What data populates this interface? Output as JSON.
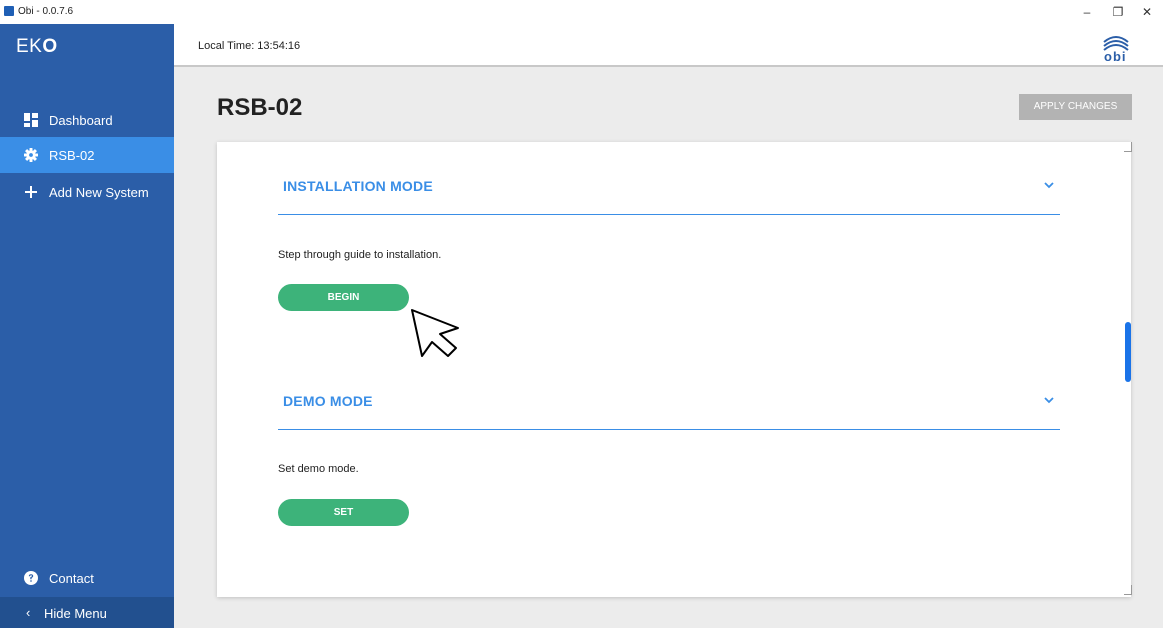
{
  "window": {
    "title": "Obi - 0.0.7.6",
    "min_glyph": "–",
    "restore_glyph": "❐",
    "close_glyph": "✕"
  },
  "sidebar": {
    "brand_prefix": "EK",
    "brand_suffix": "O",
    "items": [
      {
        "label": "Dashboard",
        "icon": "dashboard-icon",
        "active": false
      },
      {
        "label": "RSB-02",
        "icon": "gear-icon",
        "active": true
      },
      {
        "label": "Add New System",
        "icon": "plus-icon",
        "active": false
      }
    ],
    "contact_label": "Contact",
    "hide_menu_label": "Hide Menu",
    "hide_menu_glyph": "‹"
  },
  "header": {
    "local_time": "Local Time: 13:54:16",
    "logo_text": "obi"
  },
  "page": {
    "title": "RSB-02",
    "apply_label": "APPLY CHANGES"
  },
  "sections": [
    {
      "title": "INSTALLATION MODE",
      "description": "Step through guide to installation.",
      "button_label": "BEGIN"
    },
    {
      "title": "DEMO MODE",
      "description": "Set demo mode.",
      "button_label": "SET"
    }
  ],
  "colors": {
    "sidebar": "#2b5ea8",
    "active": "#3a8ee6",
    "accent": "#3a8ee6",
    "button_green": "#3db37a",
    "apply_disabled": "#b3b3b3"
  }
}
